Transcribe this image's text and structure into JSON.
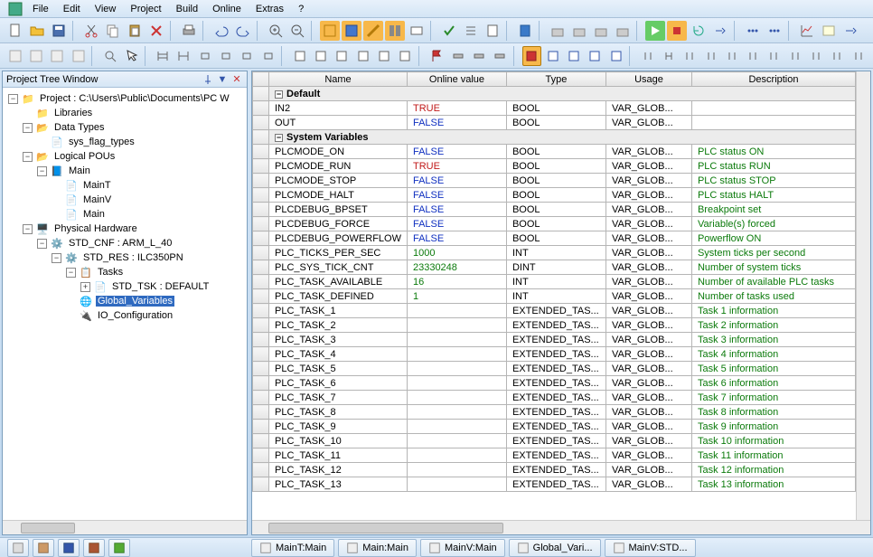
{
  "menu": [
    "File",
    "Edit",
    "View",
    "Project",
    "Build",
    "Online",
    "Extras",
    "?"
  ],
  "projectTree": {
    "title": "Project Tree Window",
    "root": "Project : C:\\Users\\Public\\Documents\\PC W",
    "libraries": "Libraries",
    "dataTypes": "Data Types",
    "sysFlag": "sys_flag_types",
    "logicalPOUs": "Logical POUs",
    "main": "Main",
    "mainT": "MainT",
    "mainV": "MainV",
    "mainPou": "Main",
    "physHw": "Physical Hardware",
    "stdCnf": "STD_CNF : ARM_L_40",
    "stdRes": "STD_RES : ILC350PN",
    "tasks": "Tasks",
    "stdTsk": "STD_TSK : DEFAULT",
    "globalVars": "Global_Variables",
    "ioConfig": "IO_Configuration"
  },
  "gridHeaders": [
    "",
    "Name",
    "Online value",
    "Type",
    "Usage",
    "Description"
  ],
  "groups": {
    "default": "Default",
    "sysvars": "System Variables"
  },
  "rowsDefault": [
    {
      "name": "IN2",
      "val": "TRUE",
      "vclass": "val-true",
      "type": "BOOL",
      "usage": "VAR_GLOB...",
      "desc": ""
    },
    {
      "name": "OUT",
      "val": "FALSE",
      "vclass": "val-false",
      "type": "BOOL",
      "usage": "VAR_GLOB...",
      "desc": ""
    }
  ],
  "rowsSys": [
    {
      "name": "PLCMODE_ON",
      "val": "FALSE",
      "vclass": "val-false",
      "type": "BOOL",
      "usage": "VAR_GLOB...",
      "desc": "PLC status ON"
    },
    {
      "name": "PLCMODE_RUN",
      "val": "TRUE",
      "vclass": "val-true",
      "type": "BOOL",
      "usage": "VAR_GLOB...",
      "desc": "PLC status RUN"
    },
    {
      "name": "PLCMODE_STOP",
      "val": "FALSE",
      "vclass": "val-false",
      "type": "BOOL",
      "usage": "VAR_GLOB...",
      "desc": "PLC status STOP"
    },
    {
      "name": "PLCMODE_HALT",
      "val": "FALSE",
      "vclass": "val-false",
      "type": "BOOL",
      "usage": "VAR_GLOB...",
      "desc": "PLC status HALT"
    },
    {
      "name": "PLCDEBUG_BPSET",
      "val": "FALSE",
      "vclass": "val-false",
      "type": "BOOL",
      "usage": "VAR_GLOB...",
      "desc": "Breakpoint set"
    },
    {
      "name": "PLCDEBUG_FORCE",
      "val": "FALSE",
      "vclass": "val-false",
      "type": "BOOL",
      "usage": "VAR_GLOB...",
      "desc": "Variable(s) forced"
    },
    {
      "name": "PLCDEBUG_POWERFLOW",
      "val": "FALSE",
      "vclass": "val-false",
      "type": "BOOL",
      "usage": "VAR_GLOB...",
      "desc": "Powerflow ON"
    },
    {
      "name": "PLC_TICKS_PER_SEC",
      "val": "1000",
      "vclass": "val-num",
      "type": "INT",
      "usage": "VAR_GLOB...",
      "desc": "System ticks per second"
    },
    {
      "name": "PLC_SYS_TICK_CNT",
      "val": "23330248",
      "vclass": "val-num",
      "type": "DINT",
      "usage": "VAR_GLOB...",
      "desc": "Number of system ticks"
    },
    {
      "name": "PLC_TASK_AVAILABLE",
      "val": "16",
      "vclass": "val-num",
      "type": "INT",
      "usage": "VAR_GLOB...",
      "desc": "Number of available PLC tasks"
    },
    {
      "name": "PLC_TASK_DEFINED",
      "val": "1",
      "vclass": "val-num",
      "type": "INT",
      "usage": "VAR_GLOB...",
      "desc": "Number of tasks used"
    },
    {
      "name": "PLC_TASK_1",
      "val": "",
      "vclass": "",
      "type": "EXTENDED_TAS...",
      "usage": "VAR_GLOB...",
      "desc": "Task 1 information"
    },
    {
      "name": "PLC_TASK_2",
      "val": "",
      "vclass": "",
      "type": "EXTENDED_TAS...",
      "usage": "VAR_GLOB...",
      "desc": "Task 2 information"
    },
    {
      "name": "PLC_TASK_3",
      "val": "",
      "vclass": "",
      "type": "EXTENDED_TAS...",
      "usage": "VAR_GLOB...",
      "desc": "Task 3 information"
    },
    {
      "name": "PLC_TASK_4",
      "val": "",
      "vclass": "",
      "type": "EXTENDED_TAS...",
      "usage": "VAR_GLOB...",
      "desc": "Task 4 information"
    },
    {
      "name": "PLC_TASK_5",
      "val": "",
      "vclass": "",
      "type": "EXTENDED_TAS...",
      "usage": "VAR_GLOB...",
      "desc": "Task 5 information"
    },
    {
      "name": "PLC_TASK_6",
      "val": "",
      "vclass": "",
      "type": "EXTENDED_TAS...",
      "usage": "VAR_GLOB...",
      "desc": "Task 6 information"
    },
    {
      "name": "PLC_TASK_7",
      "val": "",
      "vclass": "",
      "type": "EXTENDED_TAS...",
      "usage": "VAR_GLOB...",
      "desc": "Task 7 information"
    },
    {
      "name": "PLC_TASK_8",
      "val": "",
      "vclass": "",
      "type": "EXTENDED_TAS...",
      "usage": "VAR_GLOB...",
      "desc": "Task 8 information"
    },
    {
      "name": "PLC_TASK_9",
      "val": "",
      "vclass": "",
      "type": "EXTENDED_TAS...",
      "usage": "VAR_GLOB...",
      "desc": "Task 9 information"
    },
    {
      "name": "PLC_TASK_10",
      "val": "",
      "vclass": "",
      "type": "EXTENDED_TAS...",
      "usage": "VAR_GLOB...",
      "desc": "Task 10 information"
    },
    {
      "name": "PLC_TASK_11",
      "val": "",
      "vclass": "",
      "type": "EXTENDED_TAS...",
      "usage": "VAR_GLOB...",
      "desc": "Task 11 information"
    },
    {
      "name": "PLC_TASK_12",
      "val": "",
      "vclass": "",
      "type": "EXTENDED_TAS...",
      "usage": "VAR_GLOB...",
      "desc": "Task 12 information"
    },
    {
      "name": "PLC_TASK_13",
      "val": "",
      "vclass": "",
      "type": "EXTENDED_TAS...",
      "usage": "VAR_GLOB...",
      "desc": "Task 13 information"
    }
  ],
  "bottomTabs": [
    "MainT:Main",
    "Main:Main",
    "MainV:Main",
    "Global_Vari...",
    "MainV:STD..."
  ]
}
